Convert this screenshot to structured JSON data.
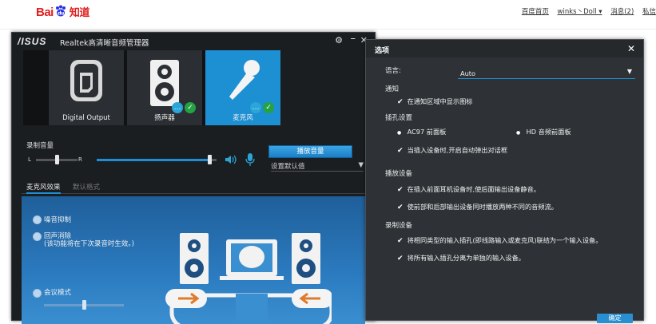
{
  "browser": {
    "logo_text": "Bai",
    "logo_text2": "百度",
    "logo_text_cn": "知道",
    "links": [
      "百度首页",
      "winks丶Doll",
      "消息(2)",
      "私信"
    ]
  },
  "realtek": {
    "brand": "/ISUS",
    "title": "Realtek高清晰音频管理器",
    "devices": [
      {
        "label": "Digital Output",
        "icon": "digital-output-icon"
      },
      {
        "label": "扬声器",
        "icon": "speaker-icon"
      },
      {
        "label": "麦克风",
        "icon": "microphone-icon"
      }
    ],
    "record_volume": {
      "label": "录制音量",
      "left": "L",
      "right": "R",
      "balance": 0.5,
      "level": 0.94
    },
    "default_button": "播放音量",
    "default_dropdown": "设置默认值",
    "tabs": [
      "麦克风效果",
      "默认格式"
    ],
    "options": {
      "noise": "噪音抑制",
      "echo": "回声消除",
      "echo_note": "(该功能将在下次录音时生效。)",
      "conference": "会议模式"
    }
  },
  "settings": {
    "title": "选项",
    "language_label": "语言:",
    "language_value": "Auto",
    "notify_header": "通知",
    "notify_item": "在通知区域中显示图标",
    "jack_header": "插孔设置",
    "ac97": "AC97 前面板",
    "hd": "HD 音频前面板",
    "auto_popup": "当插入设备时,开启自动弹出对话框",
    "playback_header": "播放设备",
    "mute_rear": "在插入前面耳机设备时,使后面输出设备静音。",
    "diff_stream": "使前部和后部输出设备同时播放两种不同的音频流。",
    "record_header": "录制设备",
    "same_type": "将相同类型的输入插孔(即线路输入或麦克风)联结为一个输入设备。",
    "separate": "将所有输入插孔分离为单独的输入设备。",
    "ok_label": "确定"
  },
  "colors": {
    "accent": "#1d8fd3",
    "dark_bg": "#1b1e21",
    "dialog_bg": "#2e3236",
    "ok_green": "#25a244"
  }
}
